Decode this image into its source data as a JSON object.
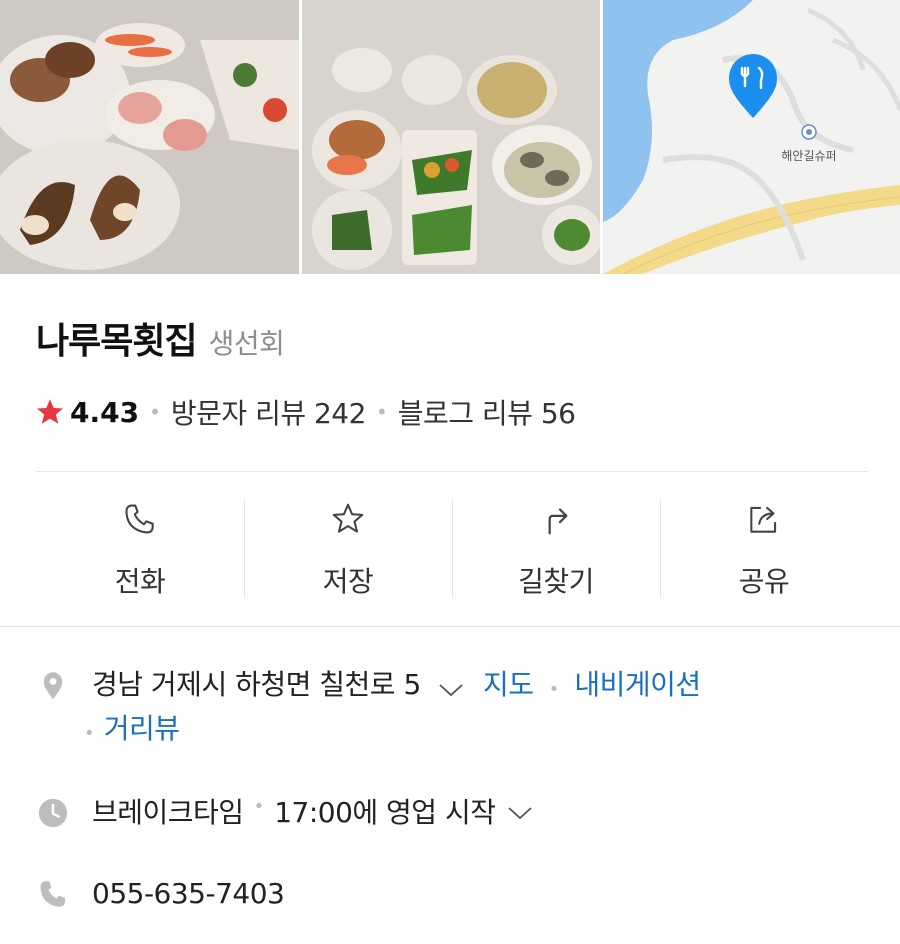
{
  "photos": {
    "map": {
      "store_label": "해안길슈퍼"
    }
  },
  "place": {
    "name": "나루목횟집",
    "category": "생선회",
    "rating": "4.43",
    "visitor_reviews": "방문자 리뷰 242",
    "blog_reviews": "블로그 리뷰 56"
  },
  "actions": [
    {
      "label": "전화",
      "icon": "phone-icon"
    },
    {
      "label": "저장",
      "icon": "star-outline-icon"
    },
    {
      "label": "길찾기",
      "icon": "directions-icon"
    },
    {
      "label": "공유",
      "icon": "share-icon"
    }
  ],
  "info": {
    "address": "경남 거제시 하청면 칠천로 5",
    "map_link": "지도",
    "navigation_link": "내비게이션",
    "street_view_link": "거리뷰",
    "hours_status": "브레이크타임",
    "hours_detail": "17:00에 영업 시작",
    "phone": "055-635-7403"
  },
  "colors": {
    "star": "#e8363f",
    "link": "#1a6fc0",
    "map_pin": "#1a8ff0",
    "map_water": "#8fc2ee",
    "map_road": "#f3d98a",
    "icon_gray": "#bdbdbd"
  }
}
